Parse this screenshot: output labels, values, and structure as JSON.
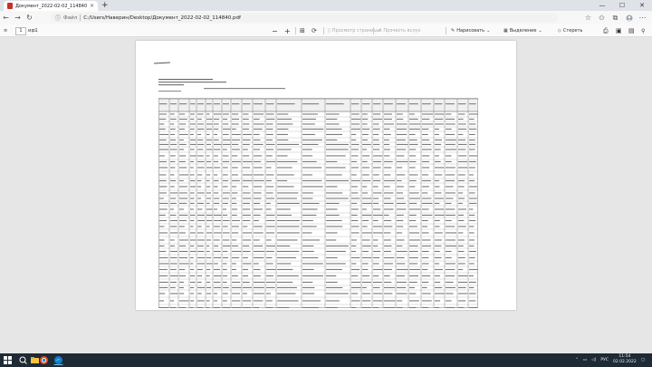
{
  "browser": {
    "tab_title": "Документ_2022-02-02_114840.pdf",
    "tab_close": "×",
    "new_tab": "+",
    "win_min": "—",
    "win_max": "☐",
    "win_close": "✕"
  },
  "address": {
    "back": "←",
    "forward": "→",
    "refresh": "↻",
    "label": "Файл",
    "url": "C:/Users/Наверин/Desktop/Документ_2022-02-02_114840.pdf"
  },
  "toolbar": {
    "contents_icon": "≡",
    "page_current": "1",
    "page_total": "из 1",
    "search_icon": "⌕",
    "zoom_out": "−",
    "zoom_in": "+",
    "fit": "⊞",
    "rotate": "⟳",
    "view_pages_label": "Просмотр страницы",
    "read_aloud_label": "Прочесть вслух",
    "draw_label": "Нарисовать",
    "highlight_label": "Выделение",
    "erase_label": "Стереть"
  },
  "taskbar": {
    "language": "РУС",
    "time": "11:54",
    "date": "02.02.2022"
  },
  "colors": {
    "pdf_icon": "#c9302c",
    "taskbar": "#1e2a34",
    "edge_blue": "#0f7bd8",
    "chrome_red": "#e64a19"
  }
}
